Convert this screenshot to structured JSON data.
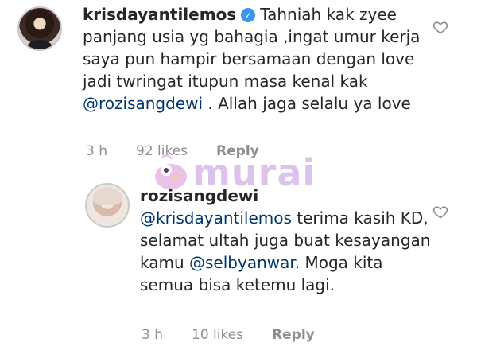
{
  "comment": {
    "username": "krisdayantilemos",
    "text_before_mention": "Tahniah kak zyee panjang usia yg bahagia ,ingat umur kerja saya pun hampir bersamaan dengan love jadi twringat itupun masa kenal kak ",
    "mention": "@rozisangdewi",
    "text_after_mention": " . Allah jaga selalu ya love",
    "time": "3 h",
    "likes": "92 likes",
    "reply_label": "Reply"
  },
  "reply": {
    "username": "rozisangdewi",
    "mention1": "@krisdayantilemos",
    "text_middle": " terima kasih KD, selamat ultah juga buat kesayangan kamu ",
    "mention2": "@selbyanwar",
    "text_end": ". Moga kita semua bisa ketemu lagi.",
    "time": "3 h",
    "likes": "10 likes",
    "reply_label": "Reply"
  },
  "watermark": {
    "text": "murai"
  },
  "colors": {
    "mention": "#00376b",
    "meta": "#8e8e8e",
    "verified": "#3897f0",
    "watermark": "#d8b8e8"
  }
}
